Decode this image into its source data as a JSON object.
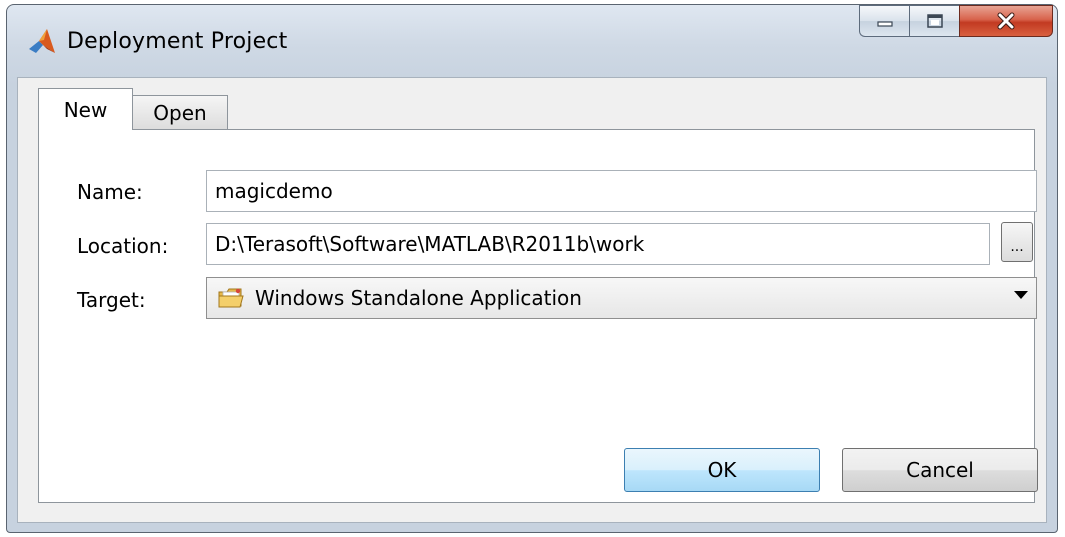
{
  "window": {
    "title": "Deployment Project",
    "controls": {
      "minimize": "minimize",
      "maximize": "maximize",
      "close": "close"
    }
  },
  "tabs": [
    {
      "label": "New",
      "active": true
    },
    {
      "label": "Open",
      "active": false
    }
  ],
  "form": {
    "name_label": "Name:",
    "name_value": "magicdemo",
    "location_label": "Location:",
    "location_value": "D:\\Terasoft\\Software\\MATLAB\\R2011b\\work",
    "browse_label": "...",
    "target_label": "Target:",
    "target_value": "Windows Standalone Application",
    "target_icon": "folder-icon"
  },
  "buttons": {
    "ok": "OK",
    "cancel": "Cancel"
  },
  "colors": {
    "ok_button": "#bee6fd",
    "close_button": "#c23a22",
    "title_bar": "#cfd9e5"
  }
}
